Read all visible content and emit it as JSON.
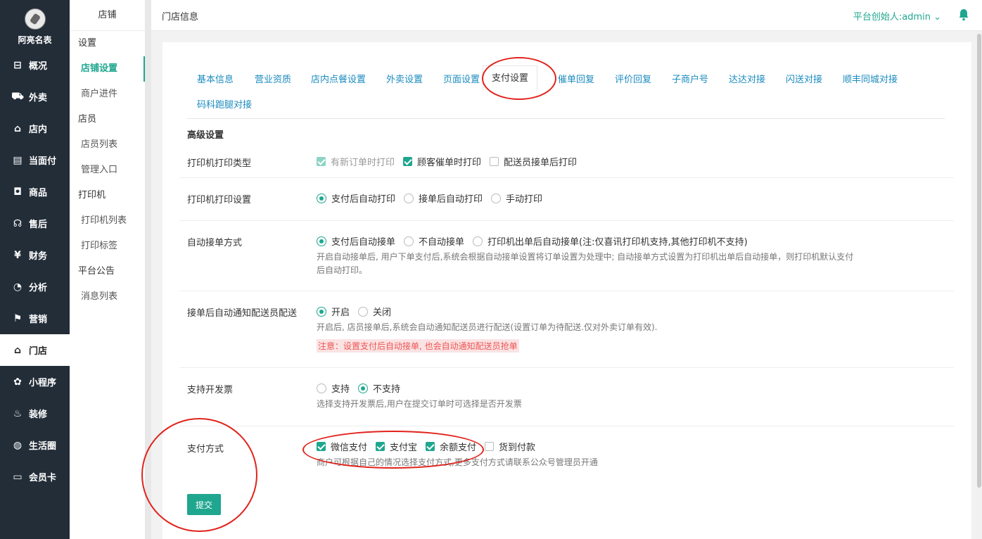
{
  "nav": {
    "shop_name": "阿亮名表",
    "items": [
      {
        "label": "概况",
        "icon": "dashboard-icon",
        "glyph": "⊟"
      },
      {
        "label": "外卖",
        "icon": "delivery-icon",
        "glyph": "⛟"
      },
      {
        "label": "店内",
        "icon": "store-icon",
        "glyph": "⌂"
      },
      {
        "label": "当面付",
        "icon": "receipt-icon",
        "glyph": "▤"
      },
      {
        "label": "商品",
        "icon": "bag-icon",
        "glyph": "◘"
      },
      {
        "label": "售后",
        "icon": "service-icon",
        "glyph": "☊"
      },
      {
        "label": "财务",
        "icon": "yen-icon",
        "glyph": "¥"
      },
      {
        "label": "分析",
        "icon": "chart-icon",
        "glyph": "◔"
      },
      {
        "label": "营销",
        "icon": "flag-icon",
        "glyph": "⚑"
      },
      {
        "label": "门店",
        "icon": "shop-icon",
        "glyph": "⌂"
      },
      {
        "label": "小程序",
        "icon": "miniapp-icon",
        "glyph": "✿"
      },
      {
        "label": "装修",
        "icon": "fire-icon",
        "glyph": "♨"
      },
      {
        "label": "生活圈",
        "icon": "globe-icon",
        "glyph": "◍"
      },
      {
        "label": "会员卡",
        "icon": "card-icon",
        "glyph": "▭"
      }
    ],
    "active_index": 9
  },
  "subnav": {
    "header": "店铺",
    "groups": [
      {
        "title": "设置",
        "items": [
          "店铺设置",
          "商户进件"
        ]
      },
      {
        "title": "店员",
        "items": [
          "店员列表",
          "管理入口"
        ]
      },
      {
        "title": "打印机",
        "items": [
          "打印机列表",
          "打印标签"
        ]
      },
      {
        "title": "平台公告",
        "items": [
          "消息列表"
        ]
      }
    ],
    "active": "店铺设置"
  },
  "topbar": {
    "breadcrumb": "门店信息",
    "user": "平台创始人:admin ⌄"
  },
  "tabs": [
    "基本信息",
    "营业资质",
    "店内点餐设置",
    "外卖设置",
    "页面设置",
    "支付设置",
    "催单回复",
    "评价回复",
    "子商户号",
    "达达对接",
    "闪送对接",
    "顺丰同城对接",
    "码科跑腿对接"
  ],
  "active_tab": "支付设置",
  "section_title": "高级设置",
  "form": {
    "print_type": {
      "label": "打印机打印类型",
      "options": [
        "有新订单时打印",
        "顾客催单时打印",
        "配送员接单后打印"
      ]
    },
    "print_setting": {
      "label": "打印机打印设置",
      "options": [
        "支付后自动打印",
        "接单后自动打印",
        "手动打印"
      ]
    },
    "auto_accept": {
      "label": "自动接单方式",
      "options": [
        "支付后自动接单",
        "不自动接单",
        "打印机出单后自动接单(注:仅喜讯打印机支持,其他打印机不支持)"
      ],
      "help_line1": "开启自动接单后, 用户下单支付后,系统会根据自动接单设置将订单设置为处理中; 自动接单方式设置为打印机出单后自动接单，则打印机默认支付",
      "help_line2": "后自动打印。"
    },
    "auto_notify": {
      "label": "接单后自动通知配送员配送",
      "options": [
        "开启",
        "关闭"
      ],
      "help": "开启后, 店员接单后,系统会自动通知配送员进行配送(设置订单为待配送.仅对外卖订单有效).",
      "warning": "注意：设置支付后自动接单, 也会自动通知配送员抢单"
    },
    "invoice": {
      "label": "支持开发票",
      "options": [
        "支持",
        "不支持"
      ],
      "help": "选择支持开发票后,用户在提交订单时可选择是否开发票"
    },
    "pay_methods": {
      "label": "支付方式",
      "options": [
        "微信支付",
        "支付宝",
        "余额支付",
        "货到付款"
      ],
      "help": "商户可根据自己的情况选择支付方式,更多支付方式请联系公众号管理员开通"
    }
  },
  "submit_label": "提交",
  "colors": {
    "accent": "#1fa68f",
    "nav_bg": "#222d38",
    "link": "#1b8bbf",
    "annotation": "#e0231c"
  }
}
